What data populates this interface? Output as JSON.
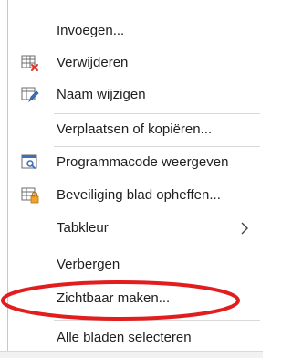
{
  "context_menu": {
    "items": [
      {
        "label": "Invoegen...",
        "icon": "none"
      },
      {
        "label": "Verwijderen",
        "icon": "delete-sheet-icon"
      },
      {
        "label": "Naam wijzigen",
        "icon": "rename-sheet-icon"
      },
      {
        "label": "Verplaatsen of kopiëren...",
        "icon": "none"
      },
      {
        "label": "Programmacode weergeven",
        "icon": "view-code-icon"
      },
      {
        "label": "Beveiliging blad opheffen...",
        "icon": "unprotect-sheet-icon"
      },
      {
        "label": "Tabkleur",
        "icon": "none",
        "submenu_indicator": ">"
      },
      {
        "label": "Verbergen",
        "icon": "none"
      },
      {
        "label": "Zichtbaar maken...",
        "icon": "none",
        "highlighted_by_annotation": true
      },
      {
        "label": "Alle bladen selecteren",
        "icon": "none"
      }
    ]
  },
  "colors": {
    "text": "#1f1f1f",
    "annotation_red": "#e11d1d",
    "separator": "#d9d9d9",
    "menu_border": "#c8c8c8",
    "icon_blue": "#3d6fb6",
    "icon_red": "#d9372b",
    "icon_orange": "#f0a22e",
    "icon_gray": "#6b6b6b"
  }
}
